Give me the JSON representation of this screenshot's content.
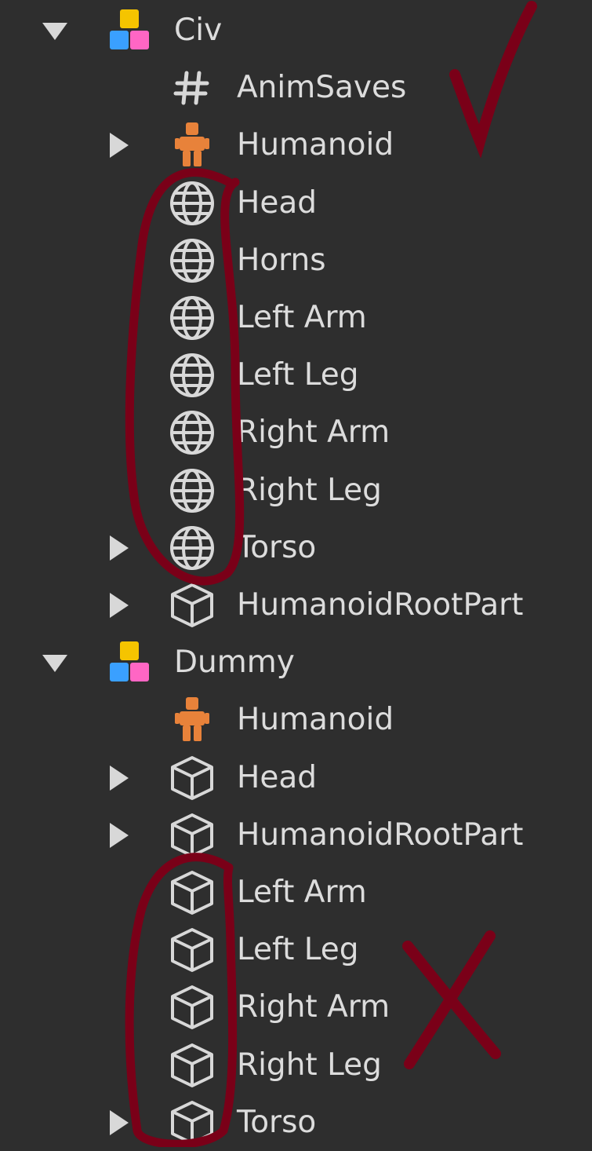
{
  "explorer": {
    "models": [
      {
        "name": "Civ",
        "expanded": true,
        "icon": "model-icon",
        "children": [
          {
            "label": "AnimSaves",
            "icon": "number-value-icon",
            "expandable": false
          },
          {
            "label": "Humanoid",
            "icon": "humanoid-icon",
            "expandable": true
          },
          {
            "label": "Head",
            "icon": "mesh-part-icon",
            "expandable": false
          },
          {
            "label": "Horns",
            "icon": "mesh-part-icon",
            "expandable": false
          },
          {
            "label": "Left Arm",
            "icon": "mesh-part-icon",
            "expandable": false
          },
          {
            "label": "Left Leg",
            "icon": "mesh-part-icon",
            "expandable": false
          },
          {
            "label": "Right Arm",
            "icon": "mesh-part-icon",
            "expandable": false
          },
          {
            "label": "Right Leg",
            "icon": "mesh-part-icon",
            "expandable": false
          },
          {
            "label": "Torso",
            "icon": "mesh-part-icon",
            "expandable": true
          },
          {
            "label": "HumanoidRootPart",
            "icon": "part-icon",
            "expandable": true
          }
        ]
      },
      {
        "name": "Dummy",
        "expanded": true,
        "icon": "model-icon",
        "children": [
          {
            "label": "Humanoid",
            "icon": "humanoid-icon",
            "expandable": false
          },
          {
            "label": "Head",
            "icon": "part-icon",
            "expandable": true
          },
          {
            "label": "HumanoidRootPart",
            "icon": "part-icon",
            "expandable": true
          },
          {
            "label": "Left Arm",
            "icon": "part-icon",
            "expandable": false
          },
          {
            "label": "Left Leg",
            "icon": "part-icon",
            "expandable": false
          },
          {
            "label": "Right Arm",
            "icon": "part-icon",
            "expandable": false
          },
          {
            "label": "Right Leg",
            "icon": "part-icon",
            "expandable": false
          },
          {
            "label": "Torso",
            "icon": "part-icon",
            "expandable": true
          }
        ]
      }
    ]
  },
  "colors": {
    "background": "#2e2e2e",
    "text": "#dcdcdc",
    "icon_gray": "#d8d8d8",
    "humanoid_orange": "#e8823a",
    "model_yellow": "#f5c400",
    "model_blue": "#3aa0ff",
    "model_pink": "#ff66c4",
    "annotation": "#7a0018"
  },
  "annotations": [
    "checkmark-icon",
    "cross-icon",
    "circle-highlight-civ-parts",
    "circle-highlight-dummy-parts"
  ]
}
